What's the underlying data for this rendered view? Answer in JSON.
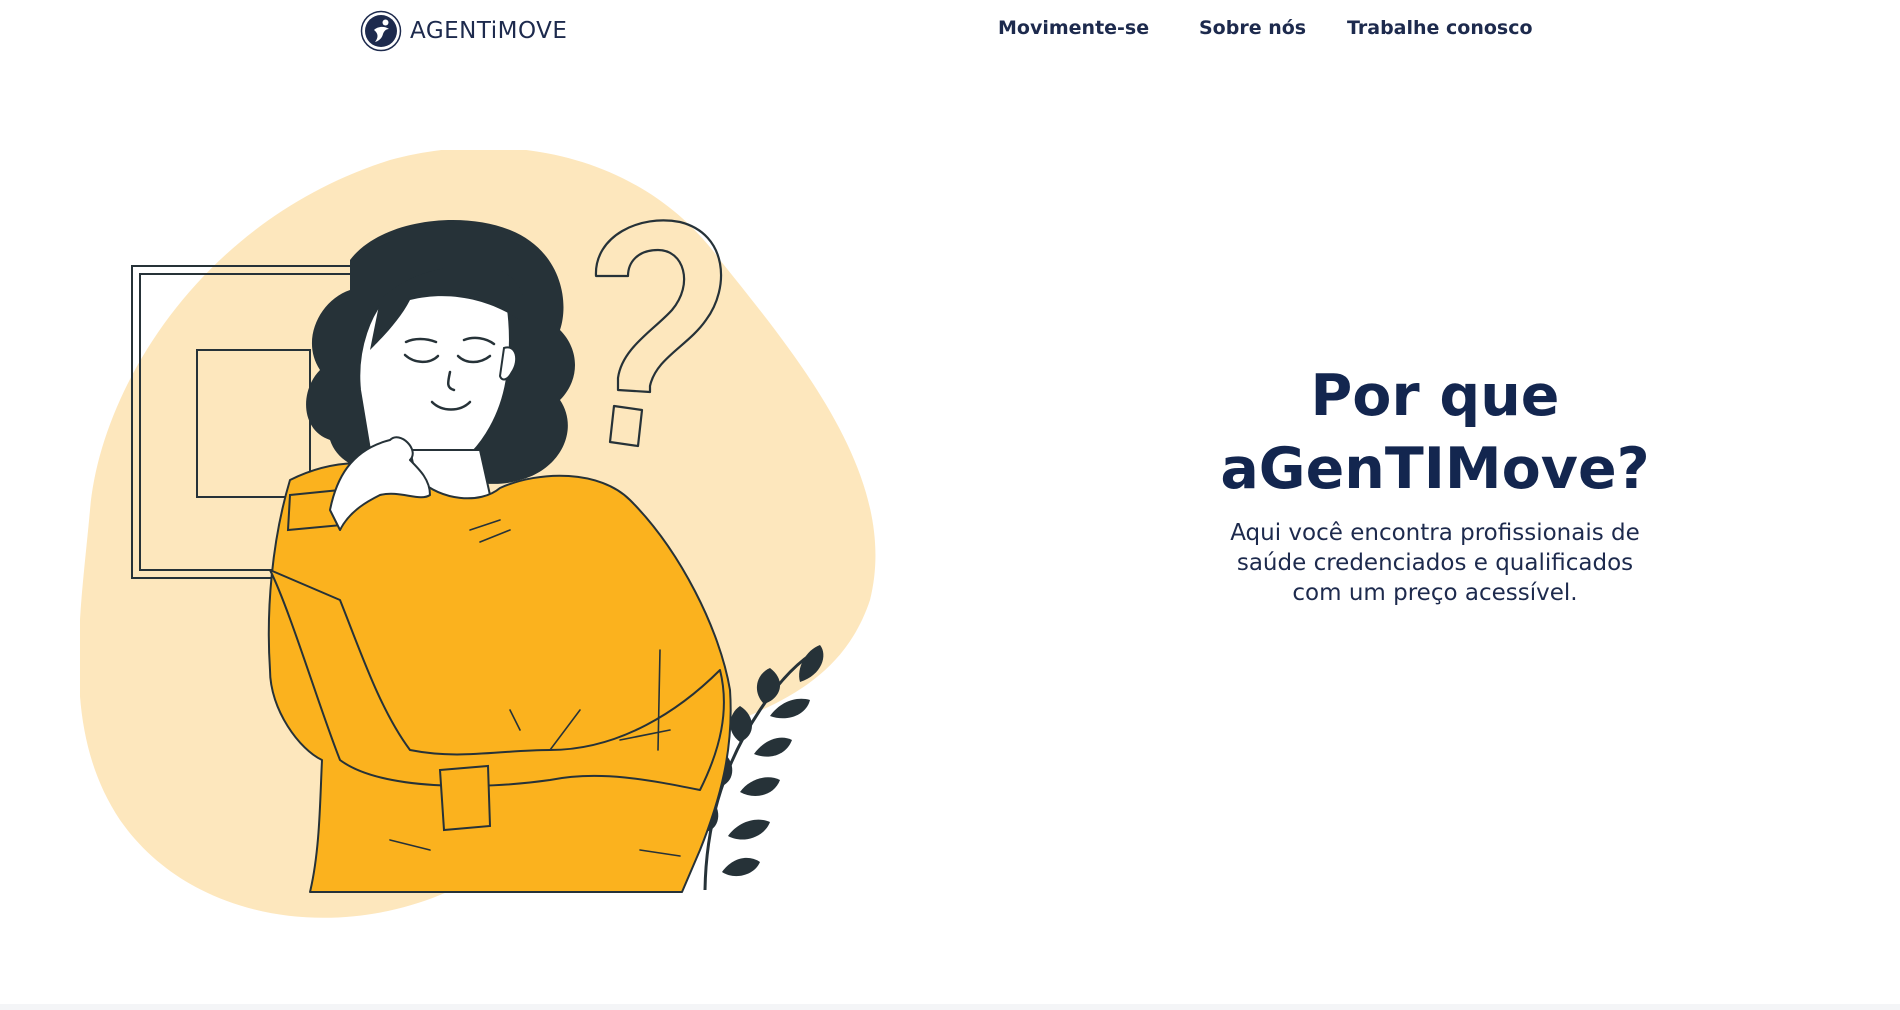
{
  "header": {
    "logo_text": "AGENTiMOVE",
    "nav": [
      {
        "label": "Movimente-se"
      },
      {
        "label": "Sobre nós"
      },
      {
        "label": "Trabalhe conosco"
      }
    ]
  },
  "hero": {
    "title_line1": "Por que",
    "title_line2": "aGenTIMove?",
    "text": "Aqui você encontra profissionais de saúde credenciados e qualificados com um preço acessível."
  },
  "colors": {
    "brand_navy": "#1d2a4d",
    "blob_cream": "#fde7bd",
    "sweater_yellow": "#fbb21e",
    "ink": "#263238"
  },
  "icons": {
    "logo_mark": "agentimove-logo-icon",
    "illustration": "thinking-woman-illustration"
  }
}
